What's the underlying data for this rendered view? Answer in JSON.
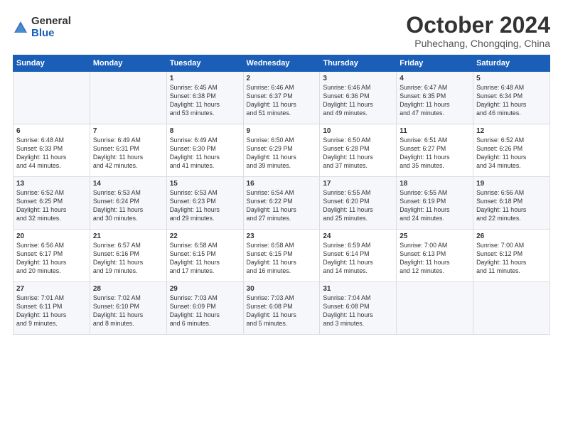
{
  "logo": {
    "general": "General",
    "blue": "Blue"
  },
  "title": "October 2024",
  "location": "Puhechang, Chongqing, China",
  "days_header": [
    "Sunday",
    "Monday",
    "Tuesday",
    "Wednesday",
    "Thursday",
    "Friday",
    "Saturday"
  ],
  "weeks": [
    [
      {
        "day": "",
        "content": ""
      },
      {
        "day": "",
        "content": ""
      },
      {
        "day": "1",
        "content": "Sunrise: 6:45 AM\nSunset: 6:38 PM\nDaylight: 11 hours\nand 53 minutes."
      },
      {
        "day": "2",
        "content": "Sunrise: 6:46 AM\nSunset: 6:37 PM\nDaylight: 11 hours\nand 51 minutes."
      },
      {
        "day": "3",
        "content": "Sunrise: 6:46 AM\nSunset: 6:36 PM\nDaylight: 11 hours\nand 49 minutes."
      },
      {
        "day": "4",
        "content": "Sunrise: 6:47 AM\nSunset: 6:35 PM\nDaylight: 11 hours\nand 47 minutes."
      },
      {
        "day": "5",
        "content": "Sunrise: 6:48 AM\nSunset: 6:34 PM\nDaylight: 11 hours\nand 46 minutes."
      }
    ],
    [
      {
        "day": "6",
        "content": "Sunrise: 6:48 AM\nSunset: 6:33 PM\nDaylight: 11 hours\nand 44 minutes."
      },
      {
        "day": "7",
        "content": "Sunrise: 6:49 AM\nSunset: 6:31 PM\nDaylight: 11 hours\nand 42 minutes."
      },
      {
        "day": "8",
        "content": "Sunrise: 6:49 AM\nSunset: 6:30 PM\nDaylight: 11 hours\nand 41 minutes."
      },
      {
        "day": "9",
        "content": "Sunrise: 6:50 AM\nSunset: 6:29 PM\nDaylight: 11 hours\nand 39 minutes."
      },
      {
        "day": "10",
        "content": "Sunrise: 6:50 AM\nSunset: 6:28 PM\nDaylight: 11 hours\nand 37 minutes."
      },
      {
        "day": "11",
        "content": "Sunrise: 6:51 AM\nSunset: 6:27 PM\nDaylight: 11 hours\nand 35 minutes."
      },
      {
        "day": "12",
        "content": "Sunrise: 6:52 AM\nSunset: 6:26 PM\nDaylight: 11 hours\nand 34 minutes."
      }
    ],
    [
      {
        "day": "13",
        "content": "Sunrise: 6:52 AM\nSunset: 6:25 PM\nDaylight: 11 hours\nand 32 minutes."
      },
      {
        "day": "14",
        "content": "Sunrise: 6:53 AM\nSunset: 6:24 PM\nDaylight: 11 hours\nand 30 minutes."
      },
      {
        "day": "15",
        "content": "Sunrise: 6:53 AM\nSunset: 6:23 PM\nDaylight: 11 hours\nand 29 minutes."
      },
      {
        "day": "16",
        "content": "Sunrise: 6:54 AM\nSunset: 6:22 PM\nDaylight: 11 hours\nand 27 minutes."
      },
      {
        "day": "17",
        "content": "Sunrise: 6:55 AM\nSunset: 6:20 PM\nDaylight: 11 hours\nand 25 minutes."
      },
      {
        "day": "18",
        "content": "Sunrise: 6:55 AM\nSunset: 6:19 PM\nDaylight: 11 hours\nand 24 minutes."
      },
      {
        "day": "19",
        "content": "Sunrise: 6:56 AM\nSunset: 6:18 PM\nDaylight: 11 hours\nand 22 minutes."
      }
    ],
    [
      {
        "day": "20",
        "content": "Sunrise: 6:56 AM\nSunset: 6:17 PM\nDaylight: 11 hours\nand 20 minutes."
      },
      {
        "day": "21",
        "content": "Sunrise: 6:57 AM\nSunset: 6:16 PM\nDaylight: 11 hours\nand 19 minutes."
      },
      {
        "day": "22",
        "content": "Sunrise: 6:58 AM\nSunset: 6:15 PM\nDaylight: 11 hours\nand 17 minutes."
      },
      {
        "day": "23",
        "content": "Sunrise: 6:58 AM\nSunset: 6:15 PM\nDaylight: 11 hours\nand 16 minutes."
      },
      {
        "day": "24",
        "content": "Sunrise: 6:59 AM\nSunset: 6:14 PM\nDaylight: 11 hours\nand 14 minutes."
      },
      {
        "day": "25",
        "content": "Sunrise: 7:00 AM\nSunset: 6:13 PM\nDaylight: 11 hours\nand 12 minutes."
      },
      {
        "day": "26",
        "content": "Sunrise: 7:00 AM\nSunset: 6:12 PM\nDaylight: 11 hours\nand 11 minutes."
      }
    ],
    [
      {
        "day": "27",
        "content": "Sunrise: 7:01 AM\nSunset: 6:11 PM\nDaylight: 11 hours\nand 9 minutes."
      },
      {
        "day": "28",
        "content": "Sunrise: 7:02 AM\nSunset: 6:10 PM\nDaylight: 11 hours\nand 8 minutes."
      },
      {
        "day": "29",
        "content": "Sunrise: 7:03 AM\nSunset: 6:09 PM\nDaylight: 11 hours\nand 6 minutes."
      },
      {
        "day": "30",
        "content": "Sunrise: 7:03 AM\nSunset: 6:08 PM\nDaylight: 11 hours\nand 5 minutes."
      },
      {
        "day": "31",
        "content": "Sunrise: 7:04 AM\nSunset: 6:08 PM\nDaylight: 11 hours\nand 3 minutes."
      },
      {
        "day": "",
        "content": ""
      },
      {
        "day": "",
        "content": ""
      }
    ]
  ]
}
